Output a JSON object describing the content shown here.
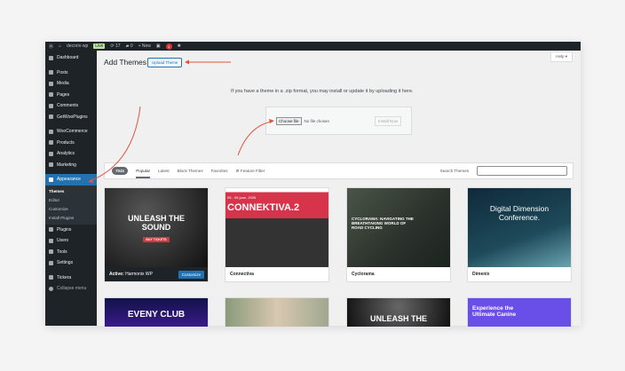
{
  "admin_bar": {
    "site": "decorix-wp",
    "status": "Live",
    "updates": "17",
    "comments": "0",
    "new": "+ New",
    "notif": "1"
  },
  "sidebar": {
    "items": [
      "Dashboard",
      "Posts",
      "Media",
      "Pages",
      "Comments",
      "GetWooPlugins",
      "WooCommerce",
      "Products",
      "Analytics",
      "Marketing",
      "Appearance",
      "Plugins",
      "Users",
      "Tools",
      "Settings",
      "Tickera",
      "Collapse menu"
    ],
    "submenu": [
      "Themes",
      "Editor",
      "Customize",
      "Install Plugins"
    ]
  },
  "header": {
    "title": "Add Themes",
    "upload": "Upload Theme",
    "help": "Help ▾"
  },
  "upload": {
    "description": "If you have a theme in a .zip format, you may install or update it by uploading it here.",
    "choose": "Choose file",
    "no_file": "No file chosen",
    "install": "Install Now"
  },
  "filter": {
    "count": "7041",
    "tabs": [
      "Popular",
      "Latest",
      "Block Themes",
      "Favorites"
    ],
    "feature": "⚙ Feature Filter",
    "search_label": "Search Themes"
  },
  "themes": [
    {
      "name": "Harmonix WP",
      "active_label": "Active:",
      "customize": "Customize",
      "preview": "UNLEASH THE SOUND",
      "sub": "BUY TICKETS"
    },
    {
      "name": "Connectiva",
      "preview": "CONNEKTIVA.2",
      "sub": "05 - 06 june, 2026"
    },
    {
      "name": "Cyclorama",
      "preview": "CYCLORAMA: NAVIGATING THE BREATHTAKING WORLD OF ROAD CYCLING"
    },
    {
      "name": "Dimenix",
      "preview": "Digital Dimension Conference."
    },
    {
      "preview": "EVENY CLUB"
    },
    {
      "preview": ""
    },
    {
      "preview": "UNLEASH THE"
    },
    {
      "preview": "Experience the Ultimate Canine"
    }
  ]
}
